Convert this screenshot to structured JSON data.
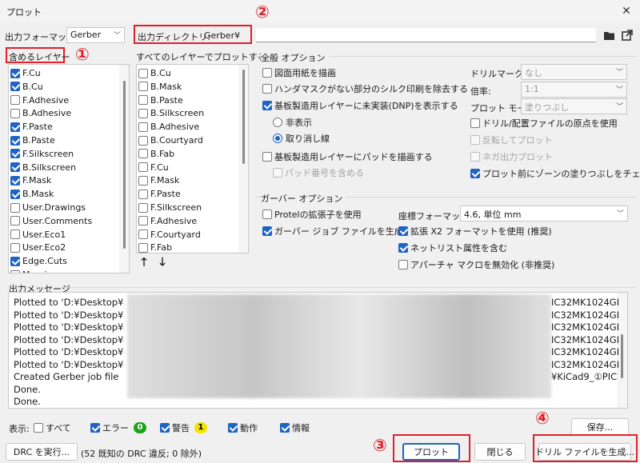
{
  "window": {
    "title": "プロット",
    "close_glyph": "✕"
  },
  "output_format": {
    "label": "出力フォーマット:",
    "value": "Gerber"
  },
  "output_dir": {
    "label": "出力ディレクトリ:",
    "value": "Gerber¥"
  },
  "annotations": {
    "n1": "①",
    "n2": "②",
    "n3": "③",
    "n4": "④"
  },
  "included_layers": {
    "title": "含めるレイヤー",
    "items": [
      {
        "label": "F.Cu",
        "checked": true
      },
      {
        "label": "B.Cu",
        "checked": true
      },
      {
        "label": "F.Adhesive",
        "checked": false
      },
      {
        "label": "B.Adhesive",
        "checked": false
      },
      {
        "label": "F.Paste",
        "checked": true
      },
      {
        "label": "B.Paste",
        "checked": true
      },
      {
        "label": "F.Silkscreen",
        "checked": true
      },
      {
        "label": "B.Silkscreen",
        "checked": true
      },
      {
        "label": "F.Mask",
        "checked": true
      },
      {
        "label": "B.Mask",
        "checked": true
      },
      {
        "label": "User.Drawings",
        "checked": false
      },
      {
        "label": "User.Comments",
        "checked": false
      },
      {
        "label": "User.Eco1",
        "checked": false
      },
      {
        "label": "User.Eco2",
        "checked": false
      },
      {
        "label": "Edge.Cuts",
        "checked": true
      },
      {
        "label": "Margin",
        "checked": false
      }
    ]
  },
  "all_layers": {
    "title": "すべてのレイヤーでプロットする",
    "items": [
      {
        "label": "B.Cu",
        "checked": false
      },
      {
        "label": "B.Mask",
        "checked": false
      },
      {
        "label": "B.Paste",
        "checked": false
      },
      {
        "label": "B.Silkscreen",
        "checked": false
      },
      {
        "label": "B.Adhesive",
        "checked": false
      },
      {
        "label": "B.Courtyard",
        "checked": false
      },
      {
        "label": "B.Fab",
        "checked": false
      },
      {
        "label": "F.Cu",
        "checked": false
      },
      {
        "label": "F.Mask",
        "checked": false
      },
      {
        "label": "F.Paste",
        "checked": false
      },
      {
        "label": "F.Silkscreen",
        "checked": false
      },
      {
        "label": "F.Adhesive",
        "checked": false
      },
      {
        "label": "F.Courtyard",
        "checked": false
      },
      {
        "label": "F.Fab",
        "checked": false
      }
    ],
    "up_glyph": "🡑",
    "down_glyph": "🡓"
  },
  "general": {
    "title": "全般 オプション",
    "plot_frame": "図面用紙を描画",
    "no_silk_mask": "ハンダマスクがない部分のシルク印刷を除去する",
    "dnp": "基板製造用レイヤーに未実装(DNP)を表示する",
    "dnp_hide": "非表示",
    "dnp_strike": "取り消し線",
    "pads_fab": "基板製造用レイヤーにパッドを描画する",
    "pad_numbers": "パッド番号を含める",
    "drill_marks_label": "ドリルマーク:",
    "drill_marks_value": "なし",
    "scale_label": "倍率:",
    "scale_value": "1:1",
    "plot_mode_label": "プロット モード:",
    "plot_mode_value": "塗りつぶし",
    "aux_origin": "ドリル/配置ファイルの原点を使用",
    "mirror": "反転してプロット",
    "negative": "ネガ出力プロット",
    "zone_fill_check": "プロット前にゾーンの塗りつぶしをチェック"
  },
  "gerber": {
    "title": "ガーバー オプション",
    "protel": "Protelの拡張子を使用",
    "job_file": "ガーバー ジョブ ファイルを生成",
    "coord_label": "座標フォーマット:",
    "coord_value": "4.6, 単位 mm",
    "x2": "拡張 X2 フォーマットを使用 (推奨)",
    "netlist": "ネットリスト属性を含む",
    "aperture": "アパーチャ マクロを無効化 (非推奨)"
  },
  "messages": {
    "title": "出力メッセージ",
    "lines": [
      {
        "left": "Plotted to 'D:¥Desktop¥",
        "right": "IC32MK1024GI"
      },
      {
        "left": "Plotted to 'D:¥Desktop¥",
        "right": "IC32MK1024GI"
      },
      {
        "left": "Plotted to 'D:¥Desktop¥",
        "right": "IC32MK1024GI"
      },
      {
        "left": "Plotted to 'D:¥Desktop¥",
        "right": "IC32MK1024GI"
      },
      {
        "left": "Plotted to 'D:¥Desktop¥",
        "right": "IC32MK1024GI"
      },
      {
        "left": "Plotted to 'D:¥Desktop¥",
        "right": "IC32MK1024GI"
      },
      {
        "left": "Created Gerber job file",
        "right": "¥KiCad9_①PIC"
      },
      {
        "left": "Done.",
        "right": ""
      },
      {
        "left": "Done.",
        "right": ""
      }
    ]
  },
  "filters": {
    "show_label": "表示:",
    "all": "すべて",
    "errors": "エラー",
    "errors_count": "0",
    "warnings": "警告",
    "warnings_count": "1",
    "actions": "動作",
    "infos": "情報"
  },
  "buttons": {
    "save": "保存...",
    "drc": "DRC を実行...",
    "drc_status": "(52 既知の DRC 違反; 0 除外)",
    "plot": "プロット",
    "close": "閉じる",
    "drill": "ドリル ファイルを生成..."
  },
  "colors": {
    "accent": "#1f63c4",
    "annotation": "#e0202a",
    "badge_green": "#1aa31a",
    "badge_yellow": "#f2e600"
  }
}
